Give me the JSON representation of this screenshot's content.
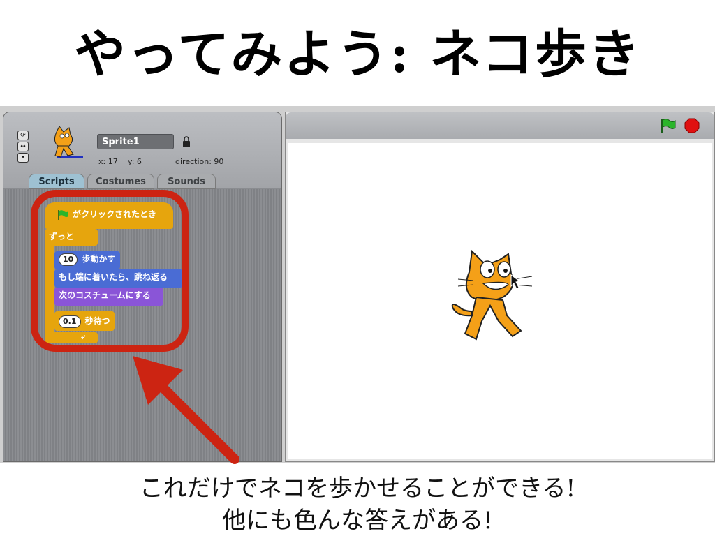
{
  "slide": {
    "title": "やってみよう: ネコ歩き",
    "caption_line1": "これだけでネコを歩かせることができる!",
    "caption_line2": "他にも色んな答えがある!"
  },
  "sprite": {
    "name": "Sprite1",
    "x_label": "x: 17",
    "y_label": "y: 6",
    "direction_label": "direction: 90"
  },
  "tabs": [
    {
      "label": "Scripts"
    },
    {
      "label": "Costumes"
    },
    {
      "label": "Sounds"
    }
  ],
  "script": {
    "hat": "がクリックされたとき",
    "forever": "ずっと",
    "move_value": "10",
    "move_label": "歩動かす",
    "bounce": "もし端に着いたら、跳ね返る",
    "next_costume": "次のコスチュームにする",
    "wait_value": "0.1",
    "wait_label": "秒待つ"
  },
  "colors": {
    "highlight": "#cc2412",
    "control": "#e6a50d",
    "motion": "#4a6cd4",
    "looks": "#8a55d7",
    "flag": "#2bb52b",
    "stop": "#e01010"
  },
  "icons": {
    "rotation_full": "rotate-icon",
    "rotation_leftright": "left-right-icon",
    "rotation_none": "no-rotate-icon",
    "lock": "lock-icon",
    "flag": "green-flag-icon",
    "stop": "stop-icon",
    "arrow": "arrow-annotation"
  }
}
